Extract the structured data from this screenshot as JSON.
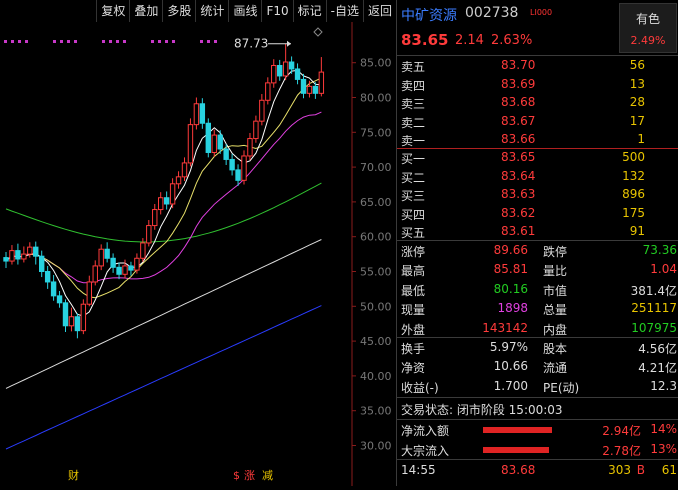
{
  "toolbar": {
    "items": [
      "复权",
      "叠加",
      "多股",
      "统计",
      "画线",
      "F10",
      "标记",
      "-自选",
      "返回"
    ]
  },
  "chart_data": {
    "type": "candlestick",
    "y_ticks": [
      "85.00",
      "80.00",
      "75.00",
      "70.00",
      "65.00",
      "60.00",
      "55.00",
      "50.00",
      "45.00",
      "40.00",
      "35.00",
      "30.00",
      "25.00",
      "20.00"
    ],
    "ylim": [
      20,
      90
    ],
    "high_marker": "87.73",
    "bottom_markers": [
      "财",
      "$",
      "涨",
      "减"
    ],
    "colors": {
      "up": "#ff3b3b",
      "down": "#28d2e0",
      "ma5": "#ffffff",
      "ma10": "#e8e06a",
      "ma20": "#e040e0",
      "ma60": "#30c030",
      "ma120": "#dcdcdc",
      "ma250": "#2a3cff"
    },
    "candles": [
      {
        "o": 57.0,
        "c": 56.5,
        "h": 57.8,
        "l": 55.5
      },
      {
        "o": 56.5,
        "c": 58.0,
        "h": 58.8,
        "l": 56.0
      },
      {
        "o": 58.0,
        "c": 56.8,
        "h": 59.0,
        "l": 56.0
      },
      {
        "o": 56.8,
        "c": 57.5,
        "h": 58.6,
        "l": 56.3
      },
      {
        "o": 57.5,
        "c": 58.5,
        "h": 59.2,
        "l": 57.0
      },
      {
        "o": 58.5,
        "c": 57.2,
        "h": 59.3,
        "l": 56.0
      },
      {
        "o": 57.2,
        "c": 55.0,
        "h": 58.0,
        "l": 54.2
      },
      {
        "o": 55.0,
        "c": 53.5,
        "h": 55.8,
        "l": 52.5
      },
      {
        "o": 53.5,
        "c": 51.5,
        "h": 54.5,
        "l": 50.8
      },
      {
        "o": 51.5,
        "c": 50.5,
        "h": 52.2,
        "l": 49.8
      },
      {
        "o": 50.5,
        "c": 47.2,
        "h": 51.0,
        "l": 46.3
      },
      {
        "o": 47.2,
        "c": 48.5,
        "h": 49.8,
        "l": 46.4
      },
      {
        "o": 48.5,
        "c": 46.5,
        "h": 49.0,
        "l": 45.4
      },
      {
        "o": 46.5,
        "c": 50.3,
        "h": 51.0,
        "l": 46.0
      },
      {
        "o": 50.3,
        "c": 53.5,
        "h": 54.4,
        "l": 50.0
      },
      {
        "o": 53.5,
        "c": 55.8,
        "h": 56.6,
        "l": 53.0
      },
      {
        "o": 55.8,
        "c": 58.2,
        "h": 58.9,
        "l": 55.2
      },
      {
        "o": 58.2,
        "c": 56.9,
        "h": 59.2,
        "l": 56.3
      },
      {
        "o": 56.9,
        "c": 55.6,
        "h": 57.6,
        "l": 54.8
      },
      {
        "o": 55.6,
        "c": 54.6,
        "h": 56.3,
        "l": 53.9
      },
      {
        "o": 54.6,
        "c": 55.8,
        "h": 56.7,
        "l": 54.0
      },
      {
        "o": 55.8,
        "c": 55.2,
        "h": 56.4,
        "l": 54.4
      },
      {
        "o": 55.2,
        "c": 56.9,
        "h": 57.6,
        "l": 54.7
      },
      {
        "o": 56.9,
        "c": 59.1,
        "h": 59.8,
        "l": 56.4
      },
      {
        "o": 59.1,
        "c": 61.6,
        "h": 62.4,
        "l": 58.6
      },
      {
        "o": 61.6,
        "c": 63.9,
        "h": 64.7,
        "l": 61.0
      },
      {
        "o": 63.9,
        "c": 65.6,
        "h": 66.4,
        "l": 63.2
      },
      {
        "o": 65.6,
        "c": 64.7,
        "h": 66.5,
        "l": 63.9
      },
      {
        "o": 64.7,
        "c": 67.6,
        "h": 68.4,
        "l": 64.1
      },
      {
        "o": 67.6,
        "c": 68.6,
        "h": 69.4,
        "l": 66.9
      },
      {
        "o": 68.6,
        "c": 70.6,
        "h": 71.4,
        "l": 68.0
      },
      {
        "o": 70.6,
        "c": 76.1,
        "h": 77.0,
        "l": 70.1
      },
      {
        "o": 76.1,
        "c": 79.1,
        "h": 80.0,
        "l": 75.4
      },
      {
        "o": 79.1,
        "c": 76.3,
        "h": 79.9,
        "l": 75.5
      },
      {
        "o": 76.3,
        "c": 72.1,
        "h": 77.0,
        "l": 71.4
      },
      {
        "o": 72.1,
        "c": 74.6,
        "h": 75.4,
        "l": 71.5
      },
      {
        "o": 74.6,
        "c": 72.6,
        "h": 75.3,
        "l": 71.9
      },
      {
        "o": 72.6,
        "c": 71.1,
        "h": 73.3,
        "l": 70.3
      },
      {
        "o": 71.1,
        "c": 69.6,
        "h": 71.9,
        "l": 68.8
      },
      {
        "o": 69.6,
        "c": 68.1,
        "h": 70.4,
        "l": 67.3
      },
      {
        "o": 68.1,
        "c": 71.6,
        "h": 72.4,
        "l": 67.5
      },
      {
        "o": 71.6,
        "c": 74.1,
        "h": 74.9,
        "l": 71.0
      },
      {
        "o": 74.1,
        "c": 76.6,
        "h": 77.4,
        "l": 73.5
      },
      {
        "o": 76.6,
        "c": 79.6,
        "h": 80.5,
        "l": 76.0
      },
      {
        "o": 79.6,
        "c": 82.1,
        "h": 82.9,
        "l": 79.0
      },
      {
        "o": 82.1,
        "c": 84.6,
        "h": 85.5,
        "l": 81.4
      },
      {
        "o": 84.6,
        "c": 83.1,
        "h": 85.4,
        "l": 82.4
      },
      {
        "o": 83.1,
        "c": 85.1,
        "h": 87.73,
        "l": 82.5
      },
      {
        "o": 85.1,
        "c": 84.1,
        "h": 85.9,
        "l": 83.4
      },
      {
        "o": 84.1,
        "c": 82.6,
        "h": 84.9,
        "l": 81.9
      },
      {
        "o": 82.6,
        "c": 80.6,
        "h": 83.4,
        "l": 79.9
      },
      {
        "o": 80.6,
        "c": 81.6,
        "h": 82.4,
        "l": 80.0
      },
      {
        "o": 81.6,
        "c": 80.6,
        "h": 82.2,
        "l": 79.8
      },
      {
        "o": 80.6,
        "c": 83.65,
        "h": 85.81,
        "l": 80.16
      }
    ]
  },
  "stock": {
    "name": "中矿资源",
    "code": "002738",
    "tag": "LI000",
    "price": "83.65",
    "change": "2.14",
    "change_pct": "2.63%",
    "sector_name": "有色",
    "sector_pct": "2.49%"
  },
  "asks": [
    {
      "label": "卖五",
      "price": "83.70",
      "vol": "56"
    },
    {
      "label": "卖四",
      "price": "83.69",
      "vol": "13"
    },
    {
      "label": "卖三",
      "price": "83.68",
      "vol": "28"
    },
    {
      "label": "卖二",
      "price": "83.67",
      "vol": "17"
    },
    {
      "label": "卖一",
      "price": "83.66",
      "vol": "1"
    }
  ],
  "bids": [
    {
      "label": "买一",
      "price": "83.65",
      "vol": "500"
    },
    {
      "label": "买二",
      "price": "83.64",
      "vol": "132"
    },
    {
      "label": "买三",
      "price": "83.63",
      "vol": "896"
    },
    {
      "label": "买四",
      "price": "83.62",
      "vol": "175"
    },
    {
      "label": "买五",
      "price": "83.61",
      "vol": "91"
    }
  ],
  "stats1": [
    {
      "l": "涨停",
      "lv": "89.66",
      "lc": "#ff3b3b",
      "r": "跌停",
      "rv": "73.36",
      "rc": "#22cc22"
    },
    {
      "l": "最高",
      "lv": "85.81",
      "lc": "#ff3b3b",
      "r": "量比",
      "rv": "1.04",
      "rc": "#ff3b3b"
    },
    {
      "l": "最低",
      "lv": "80.16",
      "lc": "#22cc22",
      "r": "市值",
      "rv": "381.4亿",
      "rc": "#dddddd"
    },
    {
      "l": "现量",
      "lv": "1898",
      "lc": "#e040e0",
      "r": "总量",
      "rv": "251117",
      "rc": "#e8c400"
    },
    {
      "l": "外盘",
      "lv": "143142",
      "lc": "#ff3b3b",
      "r": "内盘",
      "rv": "107975",
      "rc": "#22cc22"
    }
  ],
  "stats2": [
    {
      "l": "换手",
      "lv": "5.97%",
      "lc": "#dddddd",
      "r": "股本",
      "rv": "4.56亿",
      "rc": "#dddddd"
    },
    {
      "l": "净资",
      "lv": "10.66",
      "lc": "#dddddd",
      "r": "流通",
      "rv": "4.21亿",
      "rc": "#dddddd"
    },
    {
      "l": "收益(-)",
      "lv": "1.700",
      "lc": "#dddddd",
      "r": "PE(动)",
      "rv": "12.3",
      "rc": "#dddddd"
    }
  ],
  "status": "交易状态: 闭市阶段 15:00:03",
  "flows": [
    {
      "label": "净流入额",
      "amount": "2.94亿",
      "pct": "14%",
      "bar": 0.99
    },
    {
      "label": "大宗流入",
      "amount": "2.78亿",
      "pct": "13%",
      "bar": 0.94
    }
  ],
  "ticks": [
    {
      "time": "14:55",
      "price": "83.68",
      "vol": "303",
      "bs": "B",
      "n": "61"
    }
  ]
}
